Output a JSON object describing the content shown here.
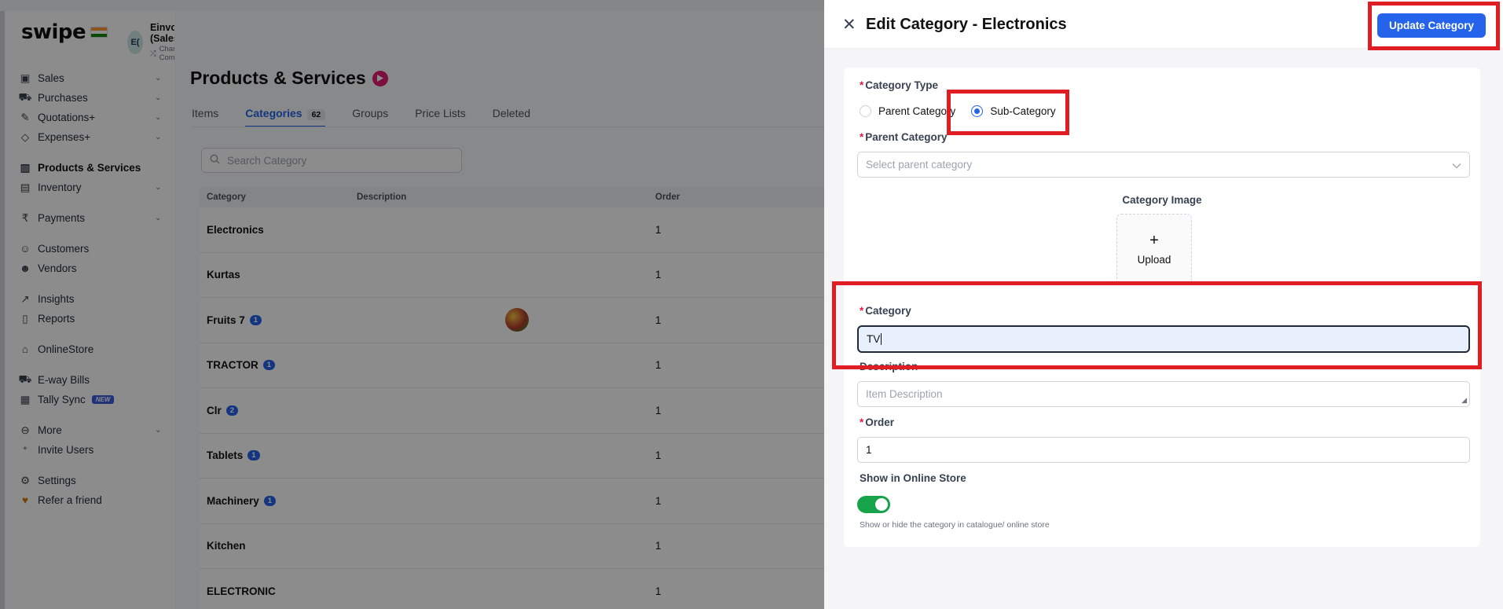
{
  "app": {
    "logo": "swipe",
    "company": {
      "avatar": "E(",
      "name": "Einvoices (Sales)",
      "change": "Change Company"
    }
  },
  "sidebar": {
    "items": [
      {
        "label": "Sales",
        "icon": "sales-icon",
        "chevron": true
      },
      {
        "label": "Purchases",
        "icon": "cart-icon",
        "chevron": true
      },
      {
        "label": "Quotations+",
        "icon": "pen-icon",
        "chevron": true
      },
      {
        "label": "Expenses+",
        "icon": "tag-icon",
        "chevron": true
      },
      {
        "label": "Products & Services",
        "icon": "barcode-icon",
        "active": true
      },
      {
        "label": "Inventory",
        "icon": "warehouse-icon",
        "chevron": true
      },
      {
        "label": "Payments",
        "icon": "rupee-icon",
        "chevron": true
      },
      {
        "label": "Customers",
        "icon": "user-icon"
      },
      {
        "label": "Vendors",
        "icon": "users-icon"
      },
      {
        "label": "Insights",
        "icon": "chart-icon"
      },
      {
        "label": "Reports",
        "icon": "file-icon"
      },
      {
        "label": "OnlineStore",
        "icon": "store-icon"
      },
      {
        "label": "E-way Bills",
        "icon": "truck-icon"
      },
      {
        "label": "Tally Sync",
        "icon": "doc-icon",
        "badge": "NEW"
      },
      {
        "label": "More",
        "icon": "more-icon",
        "chevron": true
      },
      {
        "label": "Invite Users",
        "icon": "user-plus-icon"
      },
      {
        "label": "Settings",
        "icon": "gear-icon"
      },
      {
        "label": "Refer a friend",
        "icon": "gift-icon"
      }
    ]
  },
  "main": {
    "title": "Products & Services",
    "tabs": [
      {
        "label": "Items"
      },
      {
        "label": "Categories",
        "count": "62",
        "active": true
      },
      {
        "label": "Groups"
      },
      {
        "label": "Price Lists"
      },
      {
        "label": "Deleted"
      }
    ],
    "search_placeholder": "Search Category",
    "columns": [
      "Category",
      "Description",
      "Order"
    ],
    "rows": [
      {
        "name": "Electronics",
        "order": "1"
      },
      {
        "name": "Kurtas",
        "order": "1"
      },
      {
        "name": "Fruits 7",
        "count": "1",
        "thumb": true,
        "order": "1"
      },
      {
        "name": "TRACTOR",
        "count": "1",
        "order": "1"
      },
      {
        "name": "Clr",
        "count": "2",
        "order": "1"
      },
      {
        "name": "Tablets",
        "count": "1",
        "order": "1"
      },
      {
        "name": "Machinery",
        "count": "1",
        "order": "1"
      },
      {
        "name": "Kitchen",
        "order": "1"
      },
      {
        "name": "ELECTRONIC",
        "order": "1"
      }
    ]
  },
  "drawer": {
    "title": "Edit Category - Electronics",
    "update_label": "Update Category",
    "category_type_label": "Category Type",
    "parent_option": "Parent Category",
    "sub_option": "Sub-Category",
    "parent_category_label": "Parent Category",
    "parent_placeholder": "Select parent category",
    "image_label": "Category Image",
    "upload_label": "Upload",
    "category_label": "Category",
    "category_value": "TV",
    "description_label": "Description",
    "description_placeholder": "Item Description",
    "order_label": "Order",
    "order_value": "1",
    "online_label": "Show in Online Store",
    "online_enabled": true,
    "online_hint": "Show or hide the category in catalogue/ online store"
  },
  "colors": {
    "accent": "#2563eb",
    "highlight": "#e11d24",
    "toggle_on": "#16a34a"
  }
}
